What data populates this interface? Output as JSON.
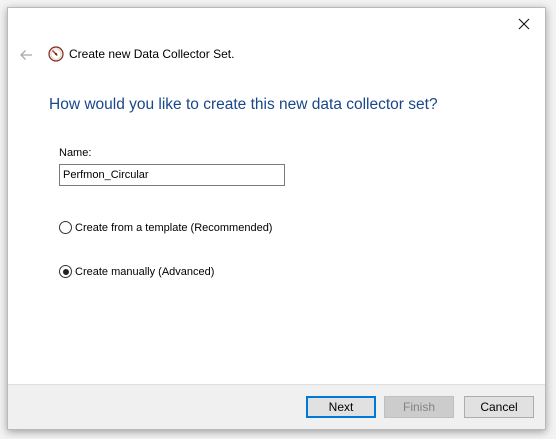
{
  "window": {
    "title": "Create new Data Collector Set."
  },
  "main": {
    "question": "How would you like to create this new data collector set?",
    "name_label": "Name:",
    "name_value": "Perfmon_Circular",
    "options": [
      {
        "label": "Create from a template (Recommended)",
        "checked": false
      },
      {
        "label": "Create manually (Advanced)",
        "checked": true
      }
    ]
  },
  "footer": {
    "next_label": "Next",
    "finish_label": "Finish",
    "cancel_label": "Cancel"
  },
  "colors": {
    "accent": "#0078d7",
    "question_text": "#19478a"
  },
  "icons": [
    "back-arrow-icon",
    "perfmon-icon",
    "close-icon"
  ]
}
